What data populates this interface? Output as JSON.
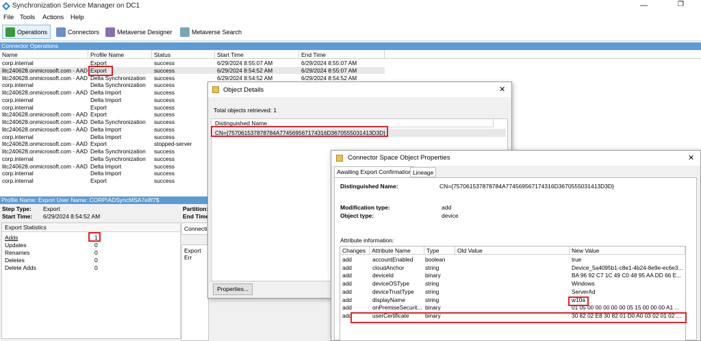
{
  "app": {
    "title": "Synchronization Service Manager on DC1"
  },
  "menu": [
    "File",
    "Tools",
    "Actions",
    "Help"
  ],
  "toolbar": [
    "Operations",
    "Connectors",
    "Metaverse Designer",
    "Metaverse Search"
  ],
  "ops": {
    "section": "Connector Operations",
    "headers": [
      "Name",
      "Profile Name",
      "Status",
      "Start Time",
      "End Time"
    ],
    "rows": [
      [
        "corp.internal",
        "Export",
        "success",
        "6/29/2024 8:55:07 AM",
        "6/29/2024 8:55:07 AM"
      ],
      [
        "litc240628.onmicrosoft.com - AAD",
        "Export",
        "success",
        "6/29/2024 8:54:52 AM",
        "6/29/2024 8:55:07 AM"
      ],
      [
        "litc240628.onmicrosoft.com - AAD",
        "Delta Synchronization",
        "success",
        "6/29/2024 8:54:52 AM",
        "6/29/2024 8:54:52 AM"
      ],
      [
        "corp.internal",
        "Delta Synchronization",
        "success",
        "",
        ""
      ],
      [
        "litc240628.onmicrosoft.com - AAD",
        "Delta Import",
        "success",
        "",
        ""
      ],
      [
        "corp.internal",
        "Delta Import",
        "success",
        "",
        ""
      ],
      [
        "corp.internal",
        "Export",
        "success",
        "",
        ""
      ],
      [
        "litc240628.onmicrosoft.com - AAD",
        "Export",
        "success",
        "",
        ""
      ],
      [
        "litc240628.onmicrosoft.com - AAD",
        "Delta Synchronization",
        "success",
        "",
        ""
      ],
      [
        "litc240628.onmicrosoft.com - AAD",
        "Delta Import",
        "success",
        "",
        ""
      ],
      [
        "corp.internal",
        "Delta Import",
        "success",
        "",
        ""
      ],
      [
        "litc240628.onmicrosoft.com - AAD",
        "Export",
        "stopped-server",
        "",
        ""
      ],
      [
        "litc240628.onmicrosoft.com - AAD",
        "Delta Synchronization",
        "success",
        "",
        ""
      ],
      [
        "corp.internal",
        "Delta Synchronization",
        "success",
        "",
        ""
      ],
      [
        "litc240628.onmicrosoft.com - AAD",
        "Delta Import",
        "success",
        "",
        ""
      ],
      [
        "corp.internal",
        "Delta Import",
        "success",
        "",
        ""
      ],
      [
        "corp.internal",
        "Export",
        "success",
        "",
        ""
      ]
    ]
  },
  "profile": {
    "bar": "Profile Name: Export  User Name: CORP\\ADSyncMSA7e8f7$",
    "step_type_label": "Step Type:",
    "step_type": "Export",
    "start_time_label": "Start Time:",
    "start_time": "6/29/2024 8:54:52 AM",
    "partition_label": "Partition:",
    "end_time_label": "End Time",
    "connection_label": "Connectio",
    "export_errors_label": "Export Err"
  },
  "export_stats": {
    "header": "Export Statistics",
    "rows": [
      [
        "Adds",
        "1"
      ],
      [
        "Updates",
        "0"
      ],
      [
        "Renames",
        "0"
      ],
      [
        "Deletes",
        "0"
      ],
      [
        "Delete Adds",
        "0"
      ]
    ]
  },
  "object_details": {
    "title": "Object Details",
    "total": "Total objects retrieved: 1",
    "col": "Distinguished Name",
    "dn": "CN={757061537878784A774569567174316D3670555031413D3D}",
    "properties_btn": "Properties..."
  },
  "cs_props": {
    "title": "Connector Space Object Properties",
    "tabs": [
      "Awaiting Export Confirmation",
      "Lineage"
    ],
    "dn_label": "Distinguished Name:",
    "dn": "CN={757061537878784A774569567174316D3670555031413D3D}",
    "mod_label": "Modification type:",
    "mod": "add",
    "obj_label": "Object type:",
    "obj": "device",
    "attr_info": "Attribute information:",
    "headers": [
      "Changes",
      "Attribute Name",
      "Type",
      "Old Value",
      "New Value"
    ],
    "rows": [
      [
        "add",
        "accountEnabled",
        "boolean",
        "",
        "true"
      ],
      [
        "add",
        "cloudAnchor",
        "string",
        "",
        "Device_5a4095b1-c8e1-4b24-8e9e-ec6e3..."
      ],
      [
        "add",
        "deviceId",
        "binary",
        "",
        "BA 96 92 C7 1C 49 C0 48 95 AA DD 66 E..."
      ],
      [
        "add",
        "deviceOSType",
        "string",
        "",
        "Windows"
      ],
      [
        "add",
        "deviceTrustType",
        "string",
        "",
        "ServerAd"
      ],
      [
        "add",
        "displayName",
        "string",
        "",
        "w10a"
      ],
      [
        "add",
        "onPremiseSecurit...",
        "binary",
        "",
        "01 05 00 00 00 00 00 05 15 00 00 00 A1 ..."
      ],
      [
        "add",
        "userCertificate",
        "binary",
        "",
        "30 82 02 E8 30 82 01 D0 A0 03 02 01 02 ..."
      ]
    ]
  }
}
